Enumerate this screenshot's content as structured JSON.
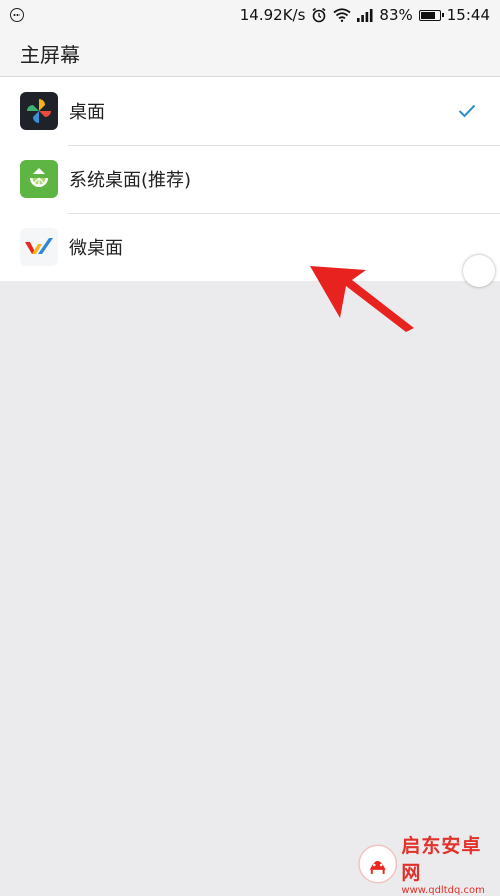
{
  "status_bar": {
    "speed": "14.92K/s",
    "battery_percent": "83%",
    "battery_level": 0.83,
    "time": "15:44",
    "icons": [
      "message-icon",
      "alarm-icon",
      "wifi-icon",
      "signal-icon",
      "battery-icon"
    ]
  },
  "header": {
    "title": "主屏幕"
  },
  "launchers": [
    {
      "label": "桌面",
      "icon": "desktop-app-icon",
      "selected": true
    },
    {
      "label": "系统桌面(推荐)",
      "icon": "system-desktop-icon",
      "selected": false
    },
    {
      "label": "微桌面",
      "icon": "micro-desktop-icon",
      "selected": false
    }
  ],
  "colors": {
    "accent": "#2d8ecf",
    "arrow": "#e8221f",
    "background": "#ebebed"
  },
  "watermark": {
    "title": "启东安卓网",
    "url": "www.qdltdq.com"
  }
}
